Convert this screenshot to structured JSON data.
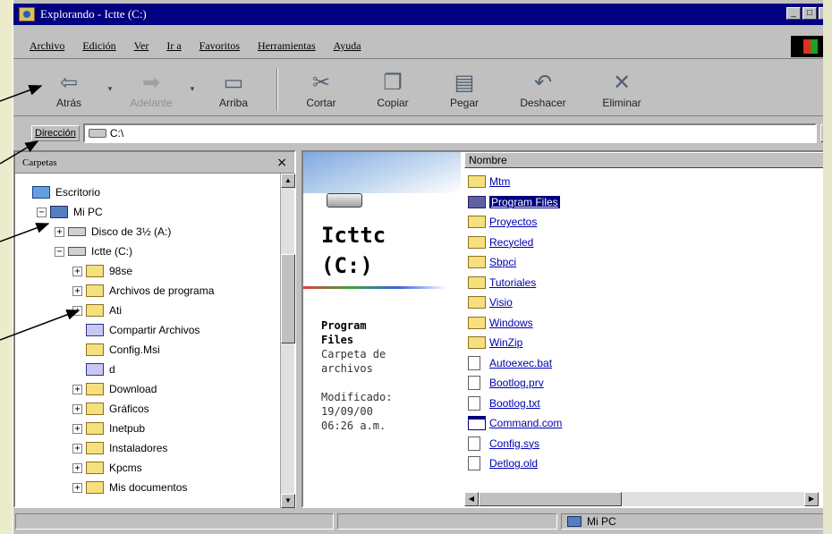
{
  "window": {
    "title": "Explorando - Ictte (C:)",
    "buttons": [
      "_",
      "□",
      "×"
    ]
  },
  "menu": [
    "Archivo",
    "Edición",
    "Ver",
    "Ir a",
    "Favoritos",
    "Herramientas",
    "Ayuda"
  ],
  "toolbar": {
    "back": "Atrás",
    "forward": "Adelante",
    "up": "Arriba",
    "cut": "Cortar",
    "copy": "Copiar",
    "paste": "Pegar",
    "undo": "Deshacer",
    "delete": "Eliminar"
  },
  "address": {
    "label": "Dirección",
    "value": "C:\\"
  },
  "folders": {
    "title": "Carpetas",
    "close": "×",
    "tree": [
      {
        "label": "Escritorio",
        "indent": 0,
        "expander": "",
        "icon": "desk"
      },
      {
        "label": "Mi PC",
        "indent": 1,
        "expander": "−",
        "icon": "computer"
      },
      {
        "label": "Disco de 3½ (A:)",
        "indent": 2,
        "expander": "+",
        "icon": "drive"
      },
      {
        "label": "Ictte (C:)",
        "indent": 2,
        "expander": "−",
        "icon": "drive"
      },
      {
        "label": "98se",
        "indent": 3,
        "expander": "+",
        "icon": "folder"
      },
      {
        "label": "Archivos de programa",
        "indent": 3,
        "expander": "+",
        "icon": "folder"
      },
      {
        "label": "Ati",
        "indent": 3,
        "expander": "+",
        "icon": "folder"
      },
      {
        "label": "Compartir Archivos",
        "indent": 3,
        "expander": "",
        "icon": "special"
      },
      {
        "label": "Config.Msi",
        "indent": 3,
        "expander": "",
        "icon": "folder"
      },
      {
        "label": "d",
        "indent": 3,
        "expander": "",
        "icon": "special"
      },
      {
        "label": "Download",
        "indent": 3,
        "expander": "+",
        "icon": "folder"
      },
      {
        "label": "Gráficos",
        "indent": 3,
        "expander": "+",
        "icon": "folder"
      },
      {
        "label": "Inetpub",
        "indent": 3,
        "expander": "+",
        "icon": "folder"
      },
      {
        "label": "Instaladores",
        "indent": 3,
        "expander": "+",
        "icon": "folder"
      },
      {
        "label": "Kpcms",
        "indent": 3,
        "expander": "+",
        "icon": "folder"
      },
      {
        "label": "Mis documentos",
        "indent": 3,
        "expander": "+",
        "icon": "folder"
      }
    ]
  },
  "webview": {
    "drive_name_line1": "Icttc",
    "drive_name_line2": "(C:)",
    "sel_name_line1": "Program",
    "sel_name_line2": "Files",
    "sel_type_line1": "Carpeta de",
    "sel_type_line2": "archivos",
    "modified_label": "Modificado:",
    "modified_date": "19/09/00",
    "modified_time": "06:26 a.m."
  },
  "list": {
    "column_name": "Nombre",
    "items": [
      {
        "label": "Mtm",
        "type": "folder"
      },
      {
        "label": "Program Files",
        "type": "selected"
      },
      {
        "label": "Proyectos",
        "type": "folder"
      },
      {
        "label": "Recycled",
        "type": "folder"
      },
      {
        "label": "Sbpci",
        "type": "folder"
      },
      {
        "label": "Tutoriales",
        "type": "folder"
      },
      {
        "label": "Visio",
        "type": "folder"
      },
      {
        "label": "Windows",
        "type": "folder"
      },
      {
        "label": "WinZip",
        "type": "folder"
      },
      {
        "label": "Autoexec.bat",
        "type": "doc"
      },
      {
        "label": "Bootlog.prv",
        "type": "doc"
      },
      {
        "label": "Bootlog.txt",
        "type": "doc"
      },
      {
        "label": "Command.com",
        "type": "exe"
      },
      {
        "label": "Config.sys",
        "type": "doc"
      },
      {
        "label": "Detlog.old",
        "type": "doc"
      }
    ]
  },
  "status": {
    "location": "Mi PC"
  },
  "colors": {
    "titlebar": "#000080",
    "face": "#c0c0c0",
    "selection": "#000080"
  }
}
